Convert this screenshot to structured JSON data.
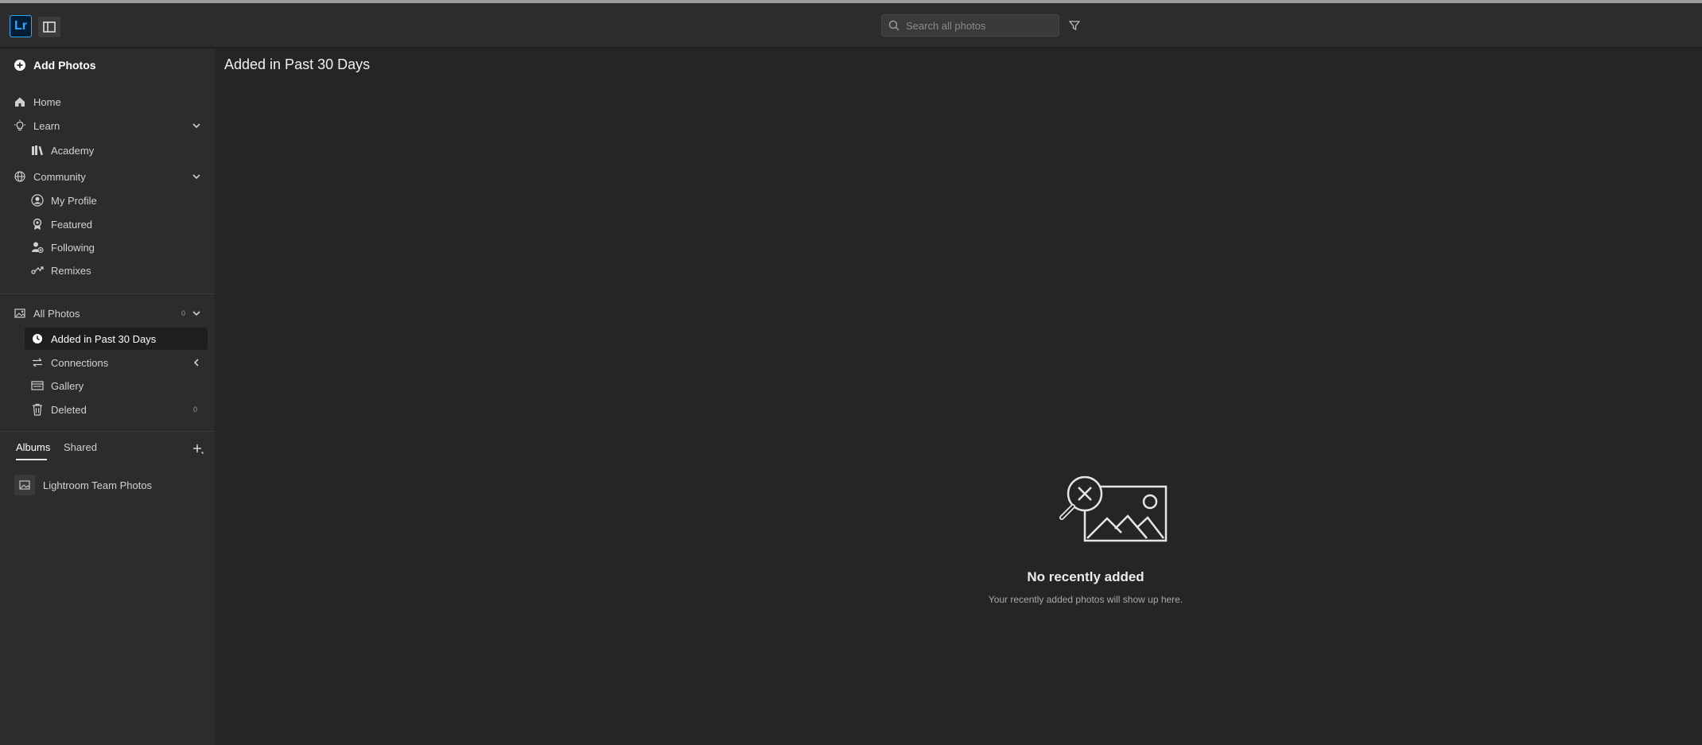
{
  "app": {
    "logo_text": "Lr",
    "accent": "#31a8ff"
  },
  "search": {
    "placeholder": "Search all photos"
  },
  "sidebar": {
    "add_photos": "Add Photos",
    "items": {
      "home": "Home",
      "learn": "Learn",
      "academy": "Academy",
      "community": "Community",
      "my_profile": "My Profile",
      "featured": "Featured",
      "following": "Following",
      "remixes": "Remixes",
      "all_photos": "All Photos",
      "all_photos_count": "0",
      "added_past_30": "Added in Past 30 Days",
      "connections": "Connections",
      "gallery": "Gallery",
      "deleted": "Deleted",
      "deleted_count": "0"
    },
    "tabs": {
      "albums": "Albums",
      "shared": "Shared"
    },
    "albums": [
      {
        "label": "Lightroom Team Photos"
      }
    ]
  },
  "main": {
    "title": "Added in Past 30 Days",
    "empty_title": "No recently added",
    "empty_subtitle": "Your recently added photos will show up here."
  },
  "icons": {
    "add": "plus-circle-icon",
    "home": "home-icon",
    "learn": "lightbulb-icon",
    "academy": "books-icon",
    "community": "globe-icon",
    "profile": "user-circle-icon",
    "featured": "award-icon",
    "following": "user-add-icon",
    "remixes": "remix-icon",
    "all_photos": "image-icon",
    "recent": "clock-icon",
    "connections": "swap-icon",
    "gallery": "gallery-icon",
    "deleted": "trash-icon",
    "search": "search-icon",
    "filter": "filter-icon"
  }
}
